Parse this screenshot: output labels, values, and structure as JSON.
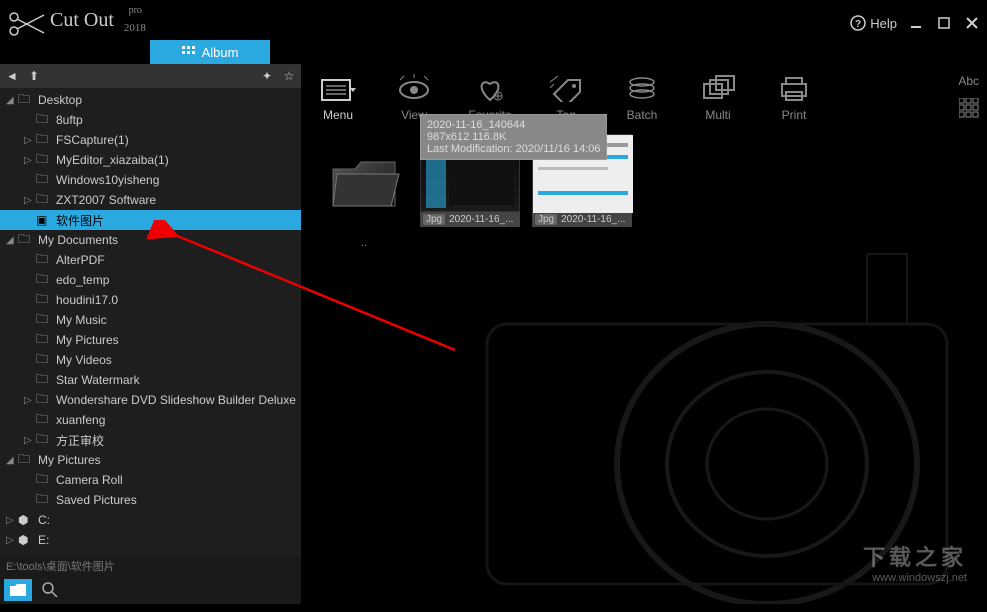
{
  "app": {
    "name": "Cut Out",
    "pro": "pro",
    "year": "2018",
    "help_label": "Help"
  },
  "album": {
    "label": "Album"
  },
  "toolbar": {
    "tools": [
      {
        "label": "Menu",
        "icon": "menu-icon",
        "active": true
      },
      {
        "label": "View",
        "icon": "view-icon"
      },
      {
        "label": "Favorite",
        "icon": "heart-icon"
      },
      {
        "label": "Tag",
        "icon": "tag-icon"
      },
      {
        "label": "Batch",
        "icon": "batch-icon"
      },
      {
        "label": "Multi",
        "icon": "multi-icon"
      },
      {
        "label": "Print",
        "icon": "print-icon"
      }
    ],
    "right": {
      "text_label": "Abc"
    }
  },
  "tree": {
    "breadcrumb": "E:\\tools\\桌面\\软件图片",
    "items": [
      {
        "label": "Desktop",
        "depth": 0,
        "expanded": true,
        "has_children": true
      },
      {
        "label": "8uftp",
        "depth": 1,
        "expanded": false,
        "has_children": false
      },
      {
        "label": "FSCapture(1)",
        "depth": 1,
        "expanded": false,
        "has_children": true
      },
      {
        "label": "MyEditor_xiazaiba(1)",
        "depth": 1,
        "expanded": false,
        "has_children": true
      },
      {
        "label": "Windows10yisheng",
        "depth": 1,
        "expanded": false,
        "has_children": false
      },
      {
        "label": "ZXT2007 Software",
        "depth": 1,
        "expanded": false,
        "has_children": true
      },
      {
        "label": "软件图片",
        "depth": 1,
        "expanded": false,
        "has_children": false,
        "selected": true,
        "special_icon": true
      },
      {
        "label": "My Documents",
        "depth": 0,
        "expanded": true,
        "has_children": true
      },
      {
        "label": "AlterPDF",
        "depth": 1,
        "expanded": false,
        "has_children": false
      },
      {
        "label": "edo_temp",
        "depth": 1,
        "expanded": false,
        "has_children": false
      },
      {
        "label": "houdini17.0",
        "depth": 1,
        "expanded": false,
        "has_children": false
      },
      {
        "label": "My Music",
        "depth": 1,
        "expanded": false,
        "has_children": false
      },
      {
        "label": "My Pictures",
        "depth": 1,
        "expanded": false,
        "has_children": false
      },
      {
        "label": "My Videos",
        "depth": 1,
        "expanded": false,
        "has_children": false
      },
      {
        "label": "Star Watermark",
        "depth": 1,
        "expanded": false,
        "has_children": false
      },
      {
        "label": "Wondershare DVD Slideshow Builder Deluxe",
        "depth": 1,
        "expanded": false,
        "has_children": true
      },
      {
        "label": "xuanfeng",
        "depth": 1,
        "expanded": false,
        "has_children": false
      },
      {
        "label": "方正审校",
        "depth": 1,
        "expanded": false,
        "has_children": true
      },
      {
        "label": "My Pictures",
        "depth": 0,
        "expanded": true,
        "has_children": true
      },
      {
        "label": "Camera Roll",
        "depth": 1,
        "expanded": false,
        "has_children": false
      },
      {
        "label": "Saved Pictures",
        "depth": 1,
        "expanded": false,
        "has_children": false
      },
      {
        "label": "C:",
        "depth": 0,
        "expanded": false,
        "has_children": true,
        "drive": true
      },
      {
        "label": "E:",
        "depth": 0,
        "expanded": false,
        "has_children": true,
        "drive": true
      }
    ]
  },
  "thumbs": {
    "parent_label": "..",
    "items": [
      {
        "ext": "Jpg",
        "name": "2020-11-16_..."
      },
      {
        "ext": "Jpg",
        "name": "2020-11-16_..."
      }
    ]
  },
  "tooltip": {
    "line1": "2020-11-16_140644",
    "line2": "987x612 116.8K",
    "line3": "Last Modification: 2020/11/16 14:06"
  },
  "watermark": {
    "cn": "下载之家",
    "url": "www.windowszj.net"
  }
}
